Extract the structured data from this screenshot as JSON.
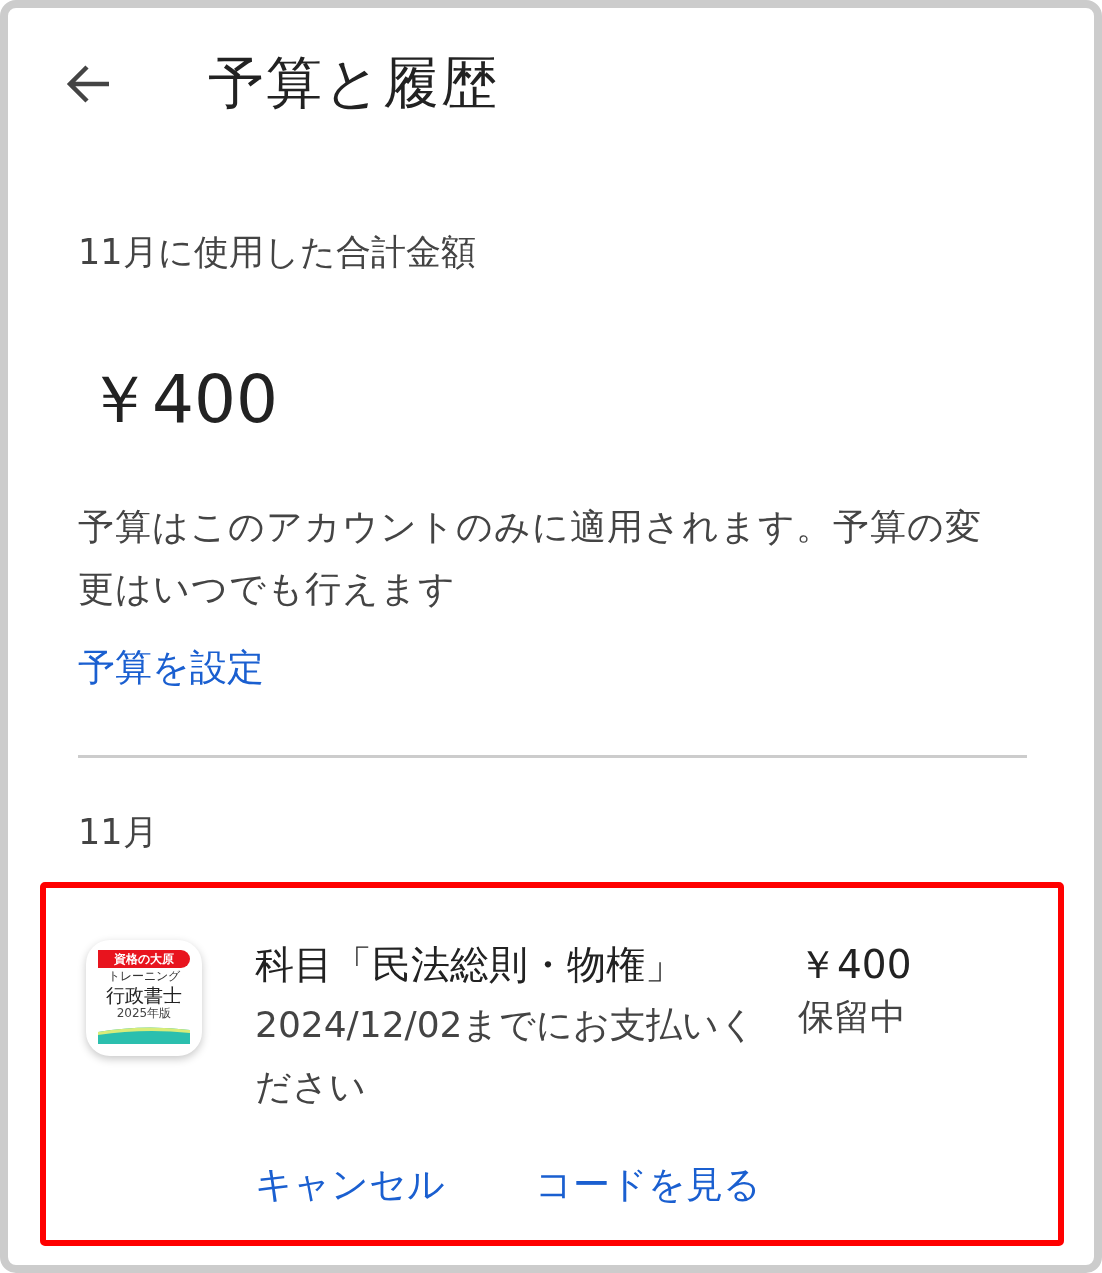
{
  "header": {
    "title": "予算と履歴"
  },
  "summary": {
    "label": "11月に使用した合計金額",
    "amount": "￥400",
    "note": "予算はこのアカウントのみに適用されます。予算の変更はいつでも行えます",
    "link": "予算を設定"
  },
  "history": [
    {
      "month": "11月",
      "transactions": [
        {
          "highlighted": true,
          "app_icon": {
            "banner": "資格の大原",
            "line_1": "トレーニング",
            "name": "行政書士",
            "edition": "2025年版"
          },
          "title": "科目「民法総則・物権」",
          "subtitle": "2024/12/02までにお支払いください",
          "price": "￥400",
          "status": "保留中",
          "actions": [
            "キャンセル",
            "コードを見る"
          ]
        }
      ]
    }
  ]
}
